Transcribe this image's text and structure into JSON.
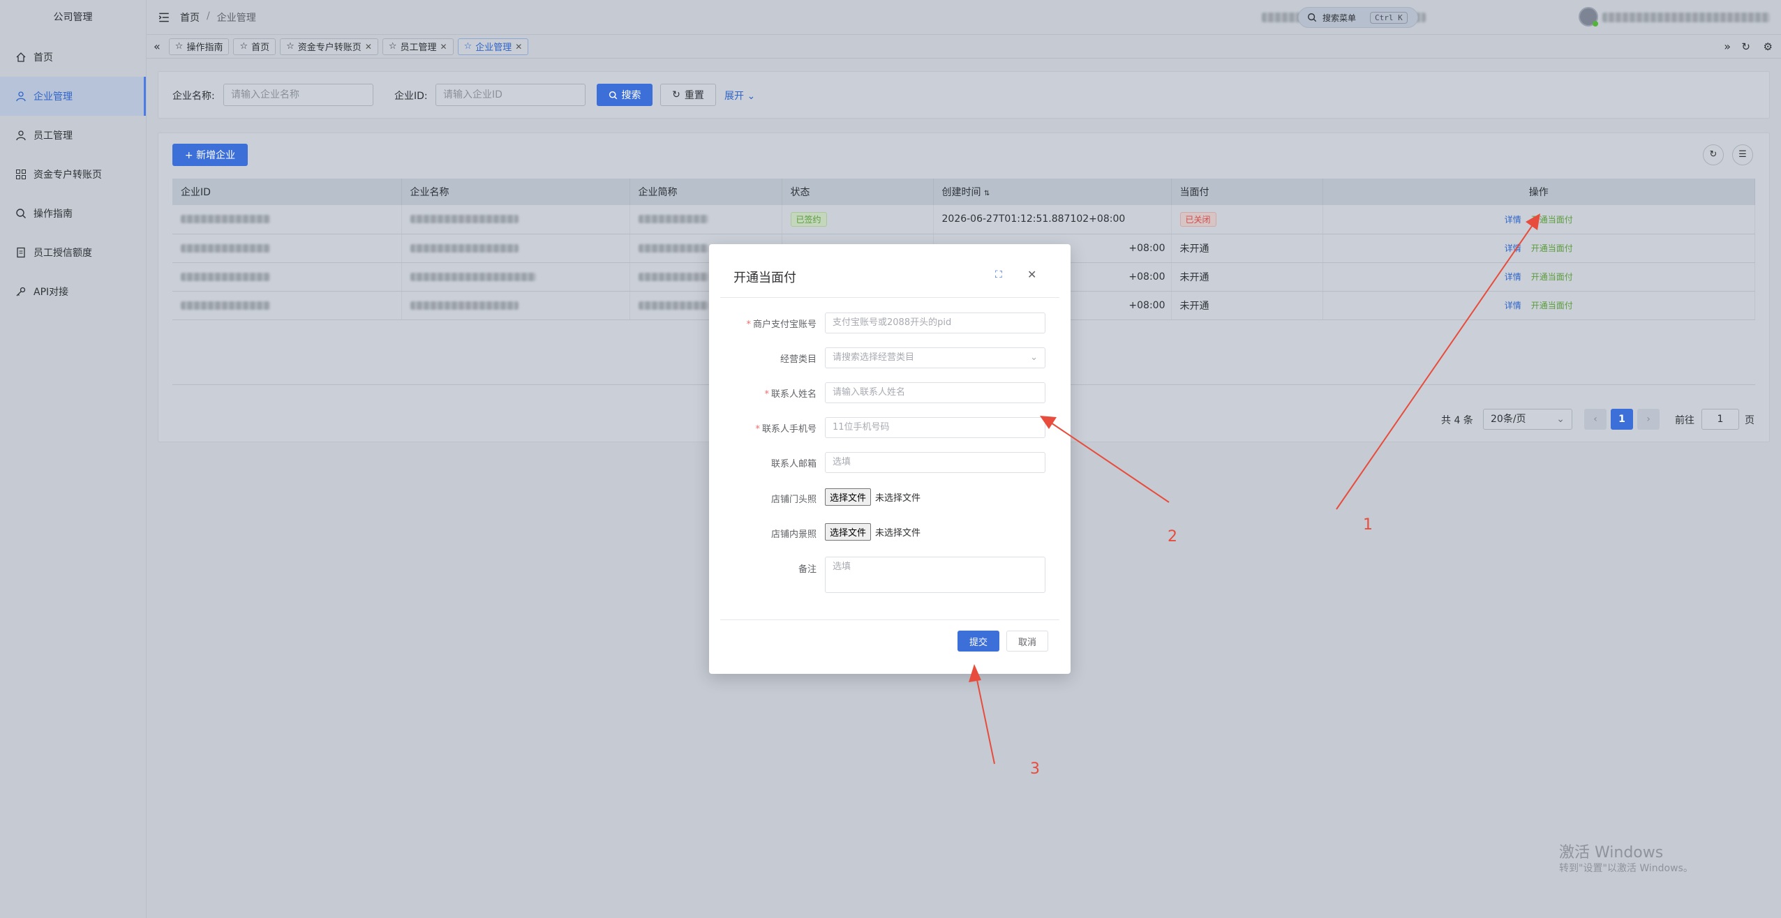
{
  "sidebar": {
    "logo": "公司管理",
    "items": [
      {
        "label": "首页",
        "icon": "home-icon"
      },
      {
        "label": "企业管理",
        "icon": "user-icon",
        "active": true
      },
      {
        "label": "员工管理",
        "icon": "user-icon"
      },
      {
        "label": "资金专户转账页",
        "icon": "grid-icon"
      },
      {
        "label": "操作指南",
        "icon": "search-icon"
      },
      {
        "label": "员工授信额度",
        "icon": "document-icon"
      },
      {
        "label": "API对接",
        "icon": "key-icon"
      }
    ]
  },
  "header": {
    "breadcrumb": [
      "首页",
      "企业管理"
    ],
    "breadcrumb_sep": "/",
    "search_menu": "搜索菜单",
    "search_shortcut": "Ctrl K"
  },
  "tags": [
    {
      "label": "操作指南",
      "closable": false
    },
    {
      "label": "首页",
      "closable": false
    },
    {
      "label": "资金专户转账页",
      "closable": true
    },
    {
      "label": "员工管理",
      "closable": true
    },
    {
      "label": "企业管理",
      "closable": true,
      "active": true
    }
  ],
  "filter": {
    "name_label": "企业名称:",
    "name_placeholder": "请输入企业名称",
    "id_label": "企业ID:",
    "id_placeholder": "请输入企业ID",
    "search_button": "搜索",
    "reset_button": "重置",
    "expand_link": "展开"
  },
  "toolbar": {
    "add_button": "+ 新增企业"
  },
  "table": {
    "columns": [
      "企业ID",
      "企业名称",
      "企业简称",
      "状态",
      "创建时间",
      "当面付",
      "操作"
    ],
    "rows": [
      {
        "status": "已签约",
        "created": "2026-06-27T01:12:51.887102+08:00",
        "face_pay": "已关闭",
        "detail": "详情",
        "open": "开通当面付"
      },
      {
        "status": "",
        "created": "+08:00",
        "face_pay": "未开通",
        "detail": "详情",
        "open": "开通当面付"
      },
      {
        "status": "",
        "created": "+08:00",
        "face_pay": "未开通",
        "detail": "详情",
        "open": "开通当面付"
      },
      {
        "status": "",
        "created": "+08:00",
        "face_pay": "未开通",
        "detail": "详情",
        "open": "开通当面付"
      }
    ]
  },
  "pagination": {
    "total": "共 4 条",
    "page_size": "20条/页",
    "current_page": "1",
    "goto_label": "前往",
    "goto_value": "1",
    "page_suffix": "页"
  },
  "modal": {
    "title": "开通当面付",
    "fields": [
      {
        "label": "商户支付宝账号",
        "required": true,
        "placeholder": "支付宝账号或2088开头的pid",
        "type": "input"
      },
      {
        "label": "经营类目",
        "required": false,
        "placeholder": "请搜索选择经营类目",
        "type": "select"
      },
      {
        "label": "联系人姓名",
        "required": true,
        "placeholder": "请输入联系人姓名",
        "type": "input"
      },
      {
        "label": "联系人手机号",
        "required": true,
        "placeholder": "11位手机号码",
        "type": "input"
      },
      {
        "label": "联系人邮箱",
        "required": false,
        "placeholder": "选填",
        "type": "input"
      },
      {
        "label": "店铺门头照",
        "required": false,
        "button": "选择文件",
        "status": "未选择文件",
        "type": "file"
      },
      {
        "label": "店铺内景照",
        "required": false,
        "button": "选择文件",
        "status": "未选择文件",
        "type": "file"
      },
      {
        "label": "备注",
        "required": false,
        "placeholder": "选填",
        "type": "textarea"
      }
    ],
    "submit": "提交",
    "cancel": "取消"
  },
  "annotations": [
    "1",
    "2",
    "3"
  ],
  "annotation_color": "#e74c3c",
  "watermark": {
    "line1": "激活 Windows",
    "line2": "转到\"设置\"以激活 Windows。"
  }
}
